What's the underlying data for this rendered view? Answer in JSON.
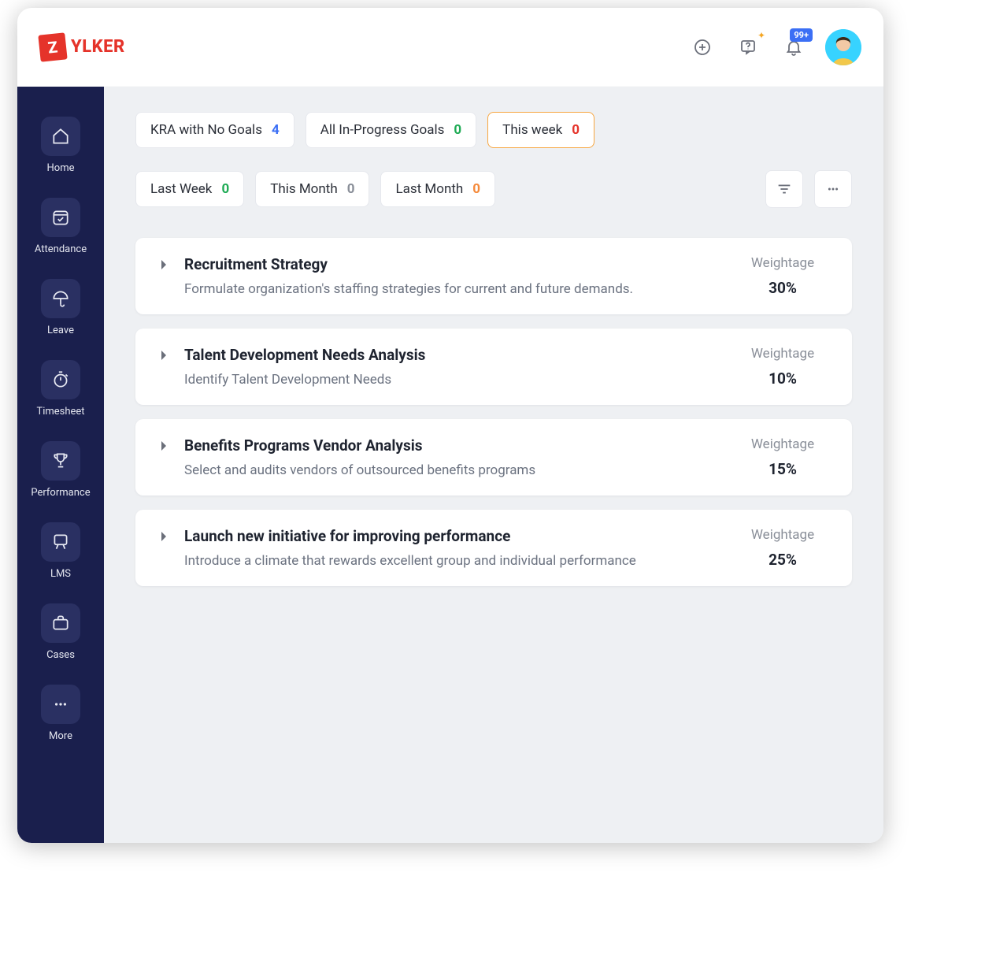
{
  "brand": {
    "mark": "Z",
    "name": "YLKER"
  },
  "topbar": {
    "notification_badge": "99+"
  },
  "sidebar": {
    "items": [
      {
        "label": "Home"
      },
      {
        "label": "Attendance"
      },
      {
        "label": "Leave"
      },
      {
        "label": "Timesheet"
      },
      {
        "label": "Performance"
      },
      {
        "label": "LMS"
      },
      {
        "label": "Cases"
      },
      {
        "label": "More"
      }
    ]
  },
  "filters": {
    "chips": [
      {
        "label": "KRA with No Goals",
        "count": "4",
        "tone": "blue",
        "active": false
      },
      {
        "label": "All In-Progress Goals",
        "count": "0",
        "tone": "green",
        "active": false
      },
      {
        "label": "This week",
        "count": "0",
        "tone": "red",
        "active": true
      },
      {
        "label": "Last Week",
        "count": "0",
        "tone": "green",
        "active": false
      },
      {
        "label": "This Month",
        "count": "0",
        "tone": "gray",
        "active": false
      },
      {
        "label": "Last Month",
        "count": "0",
        "tone": "orange",
        "active": false
      }
    ]
  },
  "weightage_label": "Weightage",
  "kras": [
    {
      "title": "Recruitment Strategy",
      "desc": "Formulate organization's staffing strategies for current and future demands.",
      "weight": "30%"
    },
    {
      "title": "Talent Development Needs Analysis",
      "desc": "Identify Talent Development Needs",
      "weight": "10%"
    },
    {
      "title": "Benefits Programs Vendor Analysis",
      "desc": "Select and audits vendors of outsourced benefits programs",
      "weight": "15%"
    },
    {
      "title": "Launch new initiative for improving performance",
      "desc": "Introduce a climate that rewards excellent group and individual performance",
      "weight": "25%"
    }
  ]
}
